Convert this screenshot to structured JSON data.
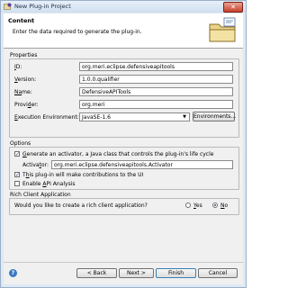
{
  "window": {
    "title": "New Plug-in Project",
    "close_glyph": "✕"
  },
  "banner": {
    "title": "Content",
    "message": "Enter the data required to generate the plug-in."
  },
  "properties": {
    "group_label": "Properties",
    "id": {
      "label_mnemonic": "I",
      "label_rest": "D:",
      "value": "org.meri.eclipse.defensiveapitools"
    },
    "version": {
      "label_mnemonic": "V",
      "label_rest": "ersion:",
      "value": "1.0.0.qualifier"
    },
    "name": {
      "label_mnemonic": "Na",
      "label_rest": "me:",
      "value": "DefensiveAPITools"
    },
    "provider": {
      "label_pre": "Provi",
      "label_mnemonic": "d",
      "label_rest": "er:",
      "value": "org.meri"
    },
    "exec_env": {
      "label_mnemonic": "E",
      "label_rest": "xecution Environment:",
      "value": "JavaSE-1.6",
      "button": "Environments..."
    }
  },
  "options": {
    "group_label": "Options",
    "generate_activator": {
      "label_mnemonic": "G",
      "label_rest": "enerate an activator, a Java class that controls the plug-in's life cycle",
      "checked": true
    },
    "activator": {
      "label_pre": "Activa",
      "label_mnemonic": "t",
      "label_rest": "or:",
      "value": "org.meri.eclipse.defensiveapitools.Activator"
    },
    "ui_contrib": {
      "label_pre": "T",
      "label_mnemonic": "h",
      "label_rest": "is plug-in will make contributions to the UI",
      "checked": true
    },
    "api_analysis": {
      "label_pre": "Enable ",
      "label_mnemonic": "A",
      "label_rest": "PI Analysis",
      "checked": false
    }
  },
  "rcp": {
    "group_label": "Rich Client Application",
    "question": "Would you like to create a rich client application?",
    "yes": {
      "label_mnemonic": "Y",
      "label_rest": "es",
      "selected": false
    },
    "no": {
      "label_mnemonic": "N",
      "label_rest": "o",
      "selected": true
    }
  },
  "footer": {
    "help_glyph": "?",
    "back": "< Back",
    "back_mnemonic": "B",
    "next": "Next >",
    "next_mnemonic": "N",
    "finish": "Finish",
    "finish_mnemonic": "F",
    "cancel": "Cancel"
  },
  "icons": {
    "app": "eclipse-plugin-icon",
    "banner": "folder-wizard-icon",
    "check": "✓",
    "dropdown": "▼"
  },
  "colors": {
    "accent": "#3c7fb1",
    "titlebar": "#cfdff0",
    "close": "#c7402c"
  }
}
